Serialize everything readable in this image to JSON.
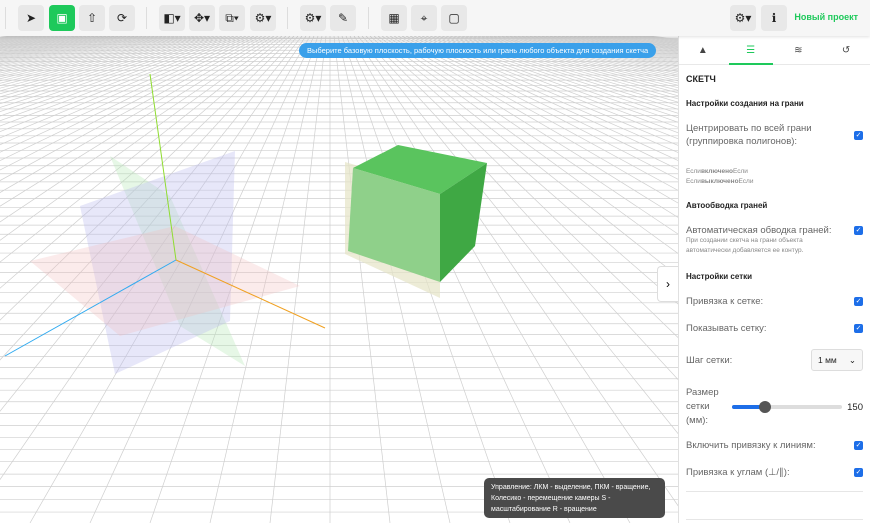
{
  "toolbar": {
    "project_name": "Новый проект"
  },
  "viewport": {
    "hint": "Выберите базовую плоскость, рабочую плоскость или грань любого объекта для создания скетча",
    "controls": "Управление: ЛКМ - выделение, ПКМ - вращение, Колесико - перемещение камеры S - масштабирование R - вращение"
  },
  "panel": {
    "title": "СКЕТЧ",
    "face_section": "Настройки создания на грани",
    "center_label": "Центрировать по всей грани (группировка полигонов):",
    "center_checked": true,
    "if_on_1": "Если",
    "if_on_2": "включено",
    "if_on_3": "Если",
    "if_off_1": "Если",
    "if_off_2": "выключено",
    "if_off_3": "Если",
    "outline_section": "Автообводка граней",
    "outline_label": "Автоматическая обводка граней:",
    "outline_checked": true,
    "outline_desc": "При создании скетча на грани объекта автоматически добавляется ее контур.",
    "grid_section": "Настройки сетки",
    "snap_grid": "Привязка к сетке:",
    "show_grid": "Показывать сетку:",
    "grid_step_label": "Шаг сетки:",
    "grid_step_value": "1 мм",
    "grid_size_label": "Размер сетки (мм):",
    "grid_size_value": "150",
    "grid_size_fraction": 0.3,
    "snap_lines": "Включить привязку к линиям:",
    "snap_angles": "Привязка к углам (⊥/∥):",
    "check": "✓"
  },
  "colors": {
    "accent": "#1ec95b",
    "hint": "#3aa0ea",
    "checkbox": "#1d6ee8"
  }
}
